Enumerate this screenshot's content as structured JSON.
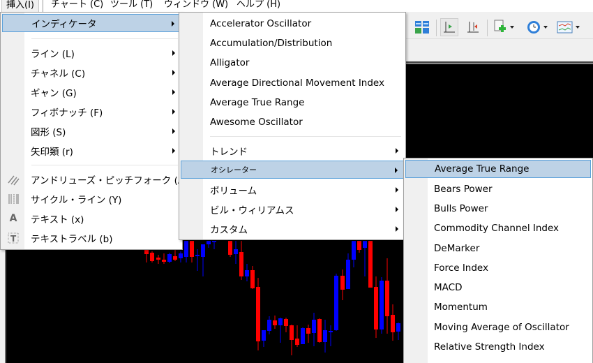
{
  "menubar": {
    "items": [
      {
        "label": "挿入(I)",
        "active": true
      },
      {
        "label": "チャート (C)"
      },
      {
        "label": "ツール (T)"
      },
      {
        "label": "ウィンドウ (W)"
      },
      {
        "label": "ヘルプ (H)"
      }
    ]
  },
  "toolbar": {
    "buttons": [
      {
        "icon": "tile-windows-icon"
      },
      {
        "icon": "auto-scroll-icon",
        "pressed": true
      },
      {
        "icon": "chart-shift-icon"
      },
      {
        "icon": "new-order-icon",
        "dropdown": true
      },
      {
        "icon": "period-clock-icon",
        "dropdown": true
      },
      {
        "icon": "templates-icon",
        "dropdown": true
      }
    ]
  },
  "insert_menu": {
    "items": [
      {
        "label": "インディケータ",
        "submenu": true,
        "highlighted": true
      },
      {
        "divider": true
      },
      {
        "label": "ライン (L)",
        "submenu": true
      },
      {
        "label": "チャネル (C)",
        "submenu": true
      },
      {
        "label": "ギャン (G)",
        "submenu": true
      },
      {
        "label": "フィボナッチ (F)",
        "submenu": true
      },
      {
        "label": "図形 (S)",
        "submenu": true
      },
      {
        "label": "矢印類 (r)",
        "submenu": true
      },
      {
        "divider": true
      },
      {
        "label": "アンドリューズ・ピッチフォーク (A)",
        "icon": "andrews-pitchfork-icon"
      },
      {
        "label": "サイクル・ライン (Y)",
        "icon": "cycle-lines-icon"
      },
      {
        "label": "テキスト (x)",
        "icon": "text-icon"
      },
      {
        "label": "テキストラベル (b)",
        "icon": "text-label-icon"
      }
    ]
  },
  "indicators_menu": {
    "items": [
      {
        "label": "Accelerator Oscillator"
      },
      {
        "label": "Accumulation/Distribution"
      },
      {
        "label": "Alligator"
      },
      {
        "label": "Average Directional Movement Index"
      },
      {
        "label": "Average True Range"
      },
      {
        "label": "Awesome Oscillator"
      },
      {
        "divider": true
      },
      {
        "label": "トレンド",
        "submenu": true
      },
      {
        "label": "オシレーター",
        "submenu": true,
        "highlighted": true
      },
      {
        "label": "ボリューム",
        "submenu": true
      },
      {
        "label": "ビル・ウィリアムス",
        "submenu": true
      },
      {
        "label": "カスタム",
        "submenu": true
      }
    ]
  },
  "oscillators_menu": {
    "items": [
      {
        "label": "Average True Range",
        "highlighted": true
      },
      {
        "label": "Bears Power"
      },
      {
        "label": "Bulls Power"
      },
      {
        "label": "Commodity Channel Index"
      },
      {
        "label": "DeMarker"
      },
      {
        "label": "Force Index"
      },
      {
        "label": "MACD"
      },
      {
        "label": "Momentum"
      },
      {
        "label": "Moving Average of Oscillator"
      },
      {
        "label": "Relative Strength Index"
      }
    ]
  },
  "chart": {
    "background": "#000000",
    "bull_color": "#0000ff",
    "bear_color": "#ff0000"
  },
  "colors": {
    "menu_highlight": "#bdd2e6",
    "menu_highlight_border": "#5ba1da"
  }
}
